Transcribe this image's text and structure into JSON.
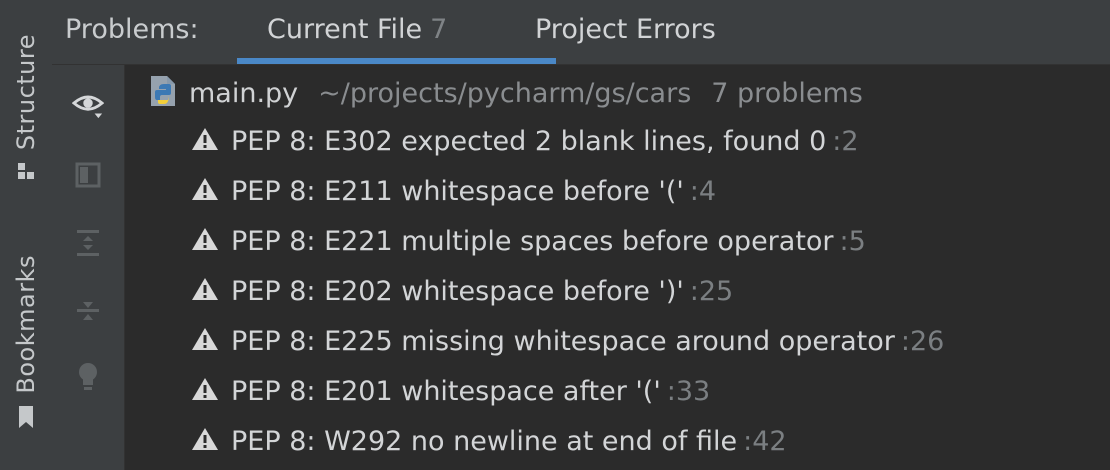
{
  "side_strip": {
    "structure_label": "Structure",
    "bookmarks_label": "Bookmarks"
  },
  "header": {
    "title": "Problems:",
    "tabs": [
      {
        "label": "Current File",
        "count": "7",
        "active": true
      },
      {
        "label": "Project Errors",
        "count": "",
        "active": false
      }
    ]
  },
  "toolbar": {
    "icons": [
      "eye-icon",
      "preview-icon",
      "expand-all-icon",
      "collapse-all-icon",
      "lightbulb-icon"
    ]
  },
  "file": {
    "name": "main.py",
    "path": "~/projects/pycharm/gs/cars",
    "count_text": "7 problems",
    "icon": "python-file-icon"
  },
  "problems": [
    {
      "text": "PEP 8: E302 expected 2 blank lines, found 0",
      "line": ":2"
    },
    {
      "text": "PEP 8: E211 whitespace before '('",
      "line": ":4"
    },
    {
      "text": "PEP 8: E221 multiple spaces before operator",
      "line": ":5"
    },
    {
      "text": "PEP 8: E202 whitespace before ')'",
      "line": ":25"
    },
    {
      "text": "PEP 8: E225 missing whitespace around operator",
      "line": ":26"
    },
    {
      "text": "PEP 8: E201 whitespace after '('",
      "line": ":33"
    },
    {
      "text": "PEP 8: W292 no newline at end of file",
      "line": ":42"
    }
  ],
  "colors": {
    "accent": "#4a88c7",
    "warning": "#c8c8c8"
  }
}
